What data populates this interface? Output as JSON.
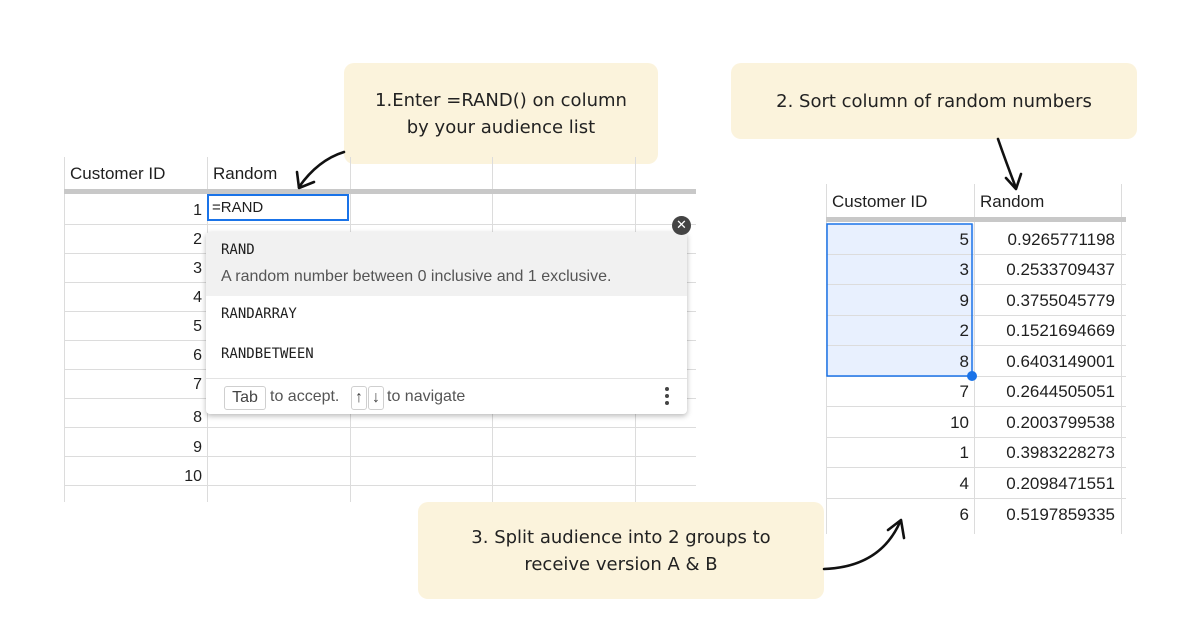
{
  "callouts": {
    "step1": {
      "line1": "1.Enter =RAND() on column",
      "line2": "by your audience list"
    },
    "step2": {
      "line1": "2. Sort column of random numbers"
    },
    "step3": {
      "line1": "3. Split audience into 2 groups to",
      "line2": "receive version A & B"
    }
  },
  "left_sheet": {
    "headers": {
      "col_a": "Customer ID",
      "col_b": "Random"
    },
    "row_numbers": [
      "1",
      "2",
      "3",
      "4",
      "5",
      "6",
      "7",
      "8",
      "9",
      "10"
    ],
    "formula_input": "=RAND",
    "autocomplete": {
      "items": [
        {
          "name": "RAND",
          "description": "A random number between 0 inclusive and 1 exclusive."
        },
        {
          "name": "RANDARRAY"
        },
        {
          "name": "RANDBETWEEN"
        }
      ],
      "footer": {
        "tab_key": "Tab",
        "accept_text": "to accept.",
        "up_key": "↑",
        "down_key": "↓",
        "navigate_text": "to navigate"
      }
    },
    "close_icon": "close-icon"
  },
  "right_sheet": {
    "headers": {
      "col_a": "Customer ID",
      "col_b": "Random"
    },
    "rows": [
      {
        "id": "5",
        "value": "0.9265771198",
        "selected": true
      },
      {
        "id": "3",
        "value": "0.2533709437",
        "selected": true
      },
      {
        "id": "9",
        "value": "0.3755045779",
        "selected": true
      },
      {
        "id": "2",
        "value": "0.1521694669",
        "selected": true
      },
      {
        "id": "8",
        "value": "0.6403149001",
        "selected": true
      },
      {
        "id": "7",
        "value": "0.2644505051",
        "selected": false
      },
      {
        "id": "10",
        "value": "0.2003799538",
        "selected": false
      },
      {
        "id": "1",
        "value": "0.3983228273",
        "selected": false
      },
      {
        "id": "4",
        "value": "0.2098471551",
        "selected": false
      },
      {
        "id": "6",
        "value": "0.5197859335",
        "selected": false
      }
    ]
  },
  "colors": {
    "callout_bg": "#fbf3dc",
    "selection_blue": "#1a73e8",
    "selection_fill": "#e8f0fe",
    "header_rule": "#c8c8c8"
  }
}
